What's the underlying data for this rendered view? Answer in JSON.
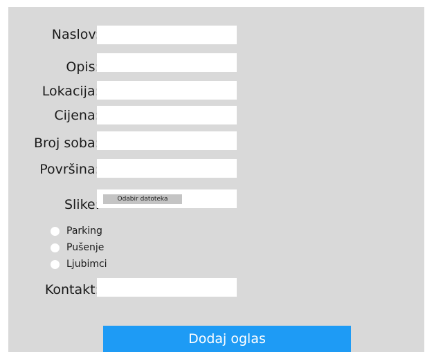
{
  "form": {
    "fields": [
      {
        "label": "Naslov:",
        "value": ""
      },
      {
        "label": "Opis:",
        "value": ""
      },
      {
        "label": "Lokacija:",
        "value": ""
      },
      {
        "label": "Cijena:",
        "value": ""
      },
      {
        "label": "Broj soba:",
        "value": ""
      },
      {
        "label": "Površina:",
        "value": ""
      }
    ],
    "images": {
      "label": "Slike:",
      "button_label": "Odabir datoteka"
    },
    "options": [
      {
        "label": "Parking",
        "checked": false
      },
      {
        "label": "Pušenje",
        "checked": false
      },
      {
        "label": "Ljubimci",
        "checked": false
      }
    ],
    "contact": {
      "label": "Kontakt:",
      "value": ""
    },
    "submit_label": "Dodaj oglas"
  },
  "colors": {
    "panel_background": "#d9d9d9",
    "field_background": "#ffffff",
    "submit_background": "#1e9bf5",
    "submit_text": "#ffffff"
  }
}
